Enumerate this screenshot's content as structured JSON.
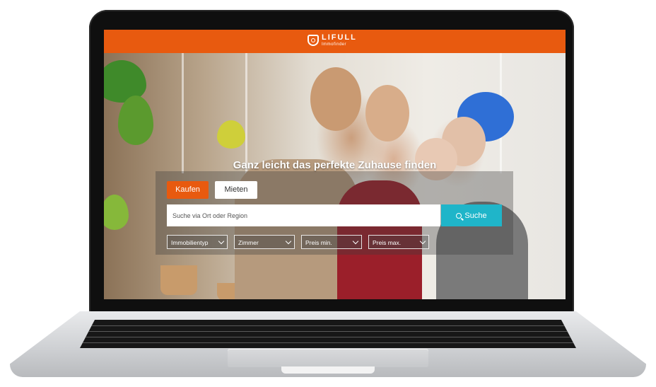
{
  "header": {
    "logo_main": "LIFULL",
    "logo_sub": "Immofinder",
    "bar_color": "#e85a0f"
  },
  "hero": {
    "headline": "Ganz leicht das perfekte Zuhause finden"
  },
  "tabs": [
    {
      "label": "Kaufen",
      "active": true
    },
    {
      "label": "Mieten",
      "active": false
    }
  ],
  "search": {
    "placeholder": "Suche via Ort oder Region",
    "button_label": "Suche",
    "button_color": "#1fb5c9"
  },
  "filters": [
    {
      "label": "Immobilientyp"
    },
    {
      "label": "Zimmer"
    },
    {
      "label": "Preis min."
    },
    {
      "label": "Preis max."
    }
  ],
  "icons": [
    "house-logo-icon",
    "search-icon",
    "chevron-down-icon"
  ]
}
